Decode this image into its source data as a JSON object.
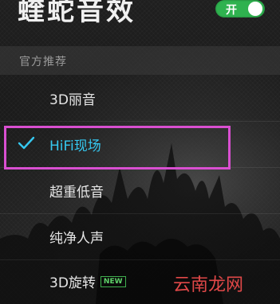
{
  "header": {
    "title": "蝰蛇音效",
    "toggle_label": "开",
    "toggle_on": true
  },
  "section": {
    "label": "官方推荐"
  },
  "items": [
    {
      "label": "3D丽音",
      "selected": false
    },
    {
      "label": "HiFi现场",
      "selected": true
    },
    {
      "label": "超重低音",
      "selected": false
    },
    {
      "label": "纯净人声",
      "selected": false
    },
    {
      "label": "3D旋转",
      "selected": false,
      "badge": "NEW"
    }
  ],
  "colors": {
    "accent": "#35c8f0",
    "toggle": "#2fb24f",
    "highlight": "#d94fd1"
  },
  "icons": {
    "check": "check-icon"
  },
  "watermark": "云南龙网"
}
